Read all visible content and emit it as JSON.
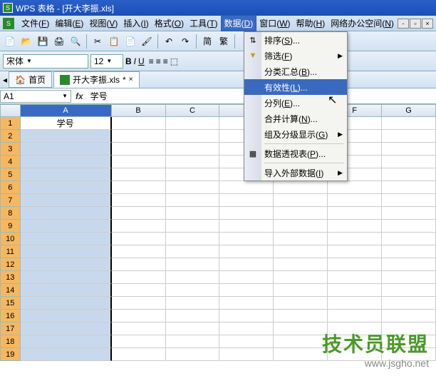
{
  "title": "WPS 表格 - [开大李振.xls]",
  "menubar": {
    "items": [
      {
        "label": "文件",
        "key": "F"
      },
      {
        "label": "编辑",
        "key": "E"
      },
      {
        "label": "视图",
        "key": "V"
      },
      {
        "label": "插入",
        "key": "I"
      },
      {
        "label": "格式",
        "key": "O"
      },
      {
        "label": "工具",
        "key": "T"
      },
      {
        "label": "数据",
        "key": "D"
      },
      {
        "label": "窗口",
        "key": "W"
      },
      {
        "label": "帮助",
        "key": "H"
      },
      {
        "label": "网络办公空间",
        "key": "N"
      }
    ]
  },
  "format": {
    "font": "宋体",
    "size": "12"
  },
  "tabs": {
    "home": "首页",
    "file": "开大李振.xls"
  },
  "namebox": "A1",
  "formula": "学号",
  "columns": [
    "A",
    "B",
    "C",
    "",
    "",
    "F",
    "G"
  ],
  "rows_count": 19,
  "cellA1": "学号",
  "dropdown": {
    "items": [
      {
        "label": "排序",
        "key": "S",
        "ellipsis": true,
        "icon": "sort"
      },
      {
        "label": "筛选",
        "key": "F",
        "submenu": true,
        "icon": "filter"
      },
      {
        "label": "分类汇总",
        "key": "B",
        "ellipsis": true
      },
      {
        "label": "有效性",
        "key": "L",
        "ellipsis": true,
        "highlight": true
      },
      {
        "label": "分列",
        "key": "E",
        "ellipsis": true
      },
      {
        "label": "合并计算",
        "key": "N",
        "ellipsis": true
      },
      {
        "label": "组及分级显示",
        "key": "G",
        "submenu": true
      },
      {
        "label": "数据透视表",
        "key": "P",
        "ellipsis": true,
        "icon": "pivot"
      },
      {
        "label": "导入外部数据",
        "key": "I",
        "submenu": true
      }
    ]
  },
  "watermark": {
    "line1": "技术员联盟",
    "line2": "www.jsgho.net"
  }
}
